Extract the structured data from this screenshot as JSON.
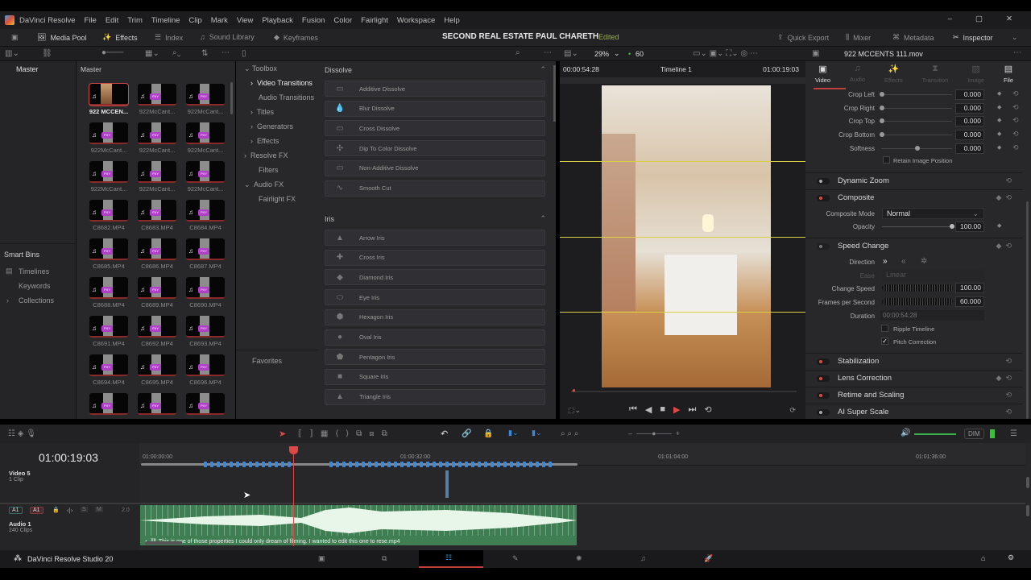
{
  "menu": {
    "app": "DaVinci Resolve",
    "items": [
      "File",
      "Edit",
      "Trim",
      "Timeline",
      "Clip",
      "Mark",
      "View",
      "Playback",
      "Fusion",
      "Color",
      "Fairlight",
      "Workspace",
      "Help"
    ]
  },
  "toolbar": {
    "media_pool": "Media Pool",
    "effects": "Effects",
    "index": "Index",
    "sound_library": "Sound Library",
    "keyframes": "Keyframes",
    "project_title": "SECOND REAL ESTATE PAUL CHARETH",
    "status": "Edited",
    "quick_export": "Quick Export",
    "mixer": "Mixer",
    "metadata": "Metadata",
    "inspector": "Inspector"
  },
  "viewer_bar": {
    "zoom": "29%",
    "fps": "60"
  },
  "bins": {
    "master": "Master",
    "smart_bins": "Smart Bins",
    "items": [
      "Timelines",
      "Keywords",
      "Collections"
    ]
  },
  "pool": {
    "title": "Master",
    "clips": [
      "922 MCCEN...",
      "922McCant...",
      "922McCant...",
      "922McCant...",
      "922McCant...",
      "922McCant...",
      "922McCant...",
      "922McCant...",
      "922McCant...",
      "C8682.MP4",
      "C8683.MP4",
      "C8684.MP4",
      "C8685.MP4",
      "C8686.MP4",
      "C8687.MP4",
      "C8688.MP4",
      "C8689.MP4",
      "C8690.MP4",
      "C8691.MP4",
      "C8692.MP4",
      "C8693.MP4",
      "C8694.MP4",
      "C8695.MP4",
      "C8696.MP4",
      "",
      "",
      ""
    ]
  },
  "effects_tree": {
    "toolbox": "Toolbox",
    "items": [
      "Video Transitions",
      "Audio Transitions",
      "Titles",
      "Generators",
      "Effects",
      "Resolve FX",
      "Filters",
      "Audio FX",
      "Fairlight FX"
    ],
    "favorites": "Favorites"
  },
  "effects": {
    "groups": [
      {
        "title": "Dissolve",
        "items": [
          "Additive Dissolve",
          "Blur Dissolve",
          "Cross Dissolve",
          "Dip To Color Dissolve",
          "Non-Additive Dissolve",
          "Smooth Cut"
        ]
      },
      {
        "title": "Iris",
        "items": [
          "Arrow Iris",
          "Cross Iris",
          "Diamond Iris",
          "Eye Iris",
          "Hexagon Iris",
          "Oval Iris",
          "Pentagon Iris",
          "Square Iris",
          "Triangle Iris"
        ]
      }
    ]
  },
  "viewer": {
    "source_tc": "00:00:54:28",
    "timeline": "Timeline 1",
    "record_tc": "01:00:19:03"
  },
  "inspector": {
    "clip_name": "922 MCCENTS 111.mov",
    "tabs": [
      "Video",
      "Audio",
      "Effects",
      "Transition",
      "Image",
      "File"
    ],
    "crop": [
      {
        "label": "Crop Left",
        "value": "0.000"
      },
      {
        "label": "Crop Right",
        "value": "0.000"
      },
      {
        "label": "Crop Top",
        "value": "0.000"
      },
      {
        "label": "Crop Bottom",
        "value": "0.000"
      },
      {
        "label": "Softness",
        "value": "0.000"
      }
    ],
    "retain": "Retain Image Position",
    "dynamic_zoom": "Dynamic Zoom",
    "composite": "Composite",
    "composite_mode_label": "Composite Mode",
    "composite_mode": "Normal",
    "opacity_label": "Opacity",
    "opacity": "100.00",
    "speed_change": "Speed Change",
    "direction": "Direction",
    "ease_label": "Ease",
    "ease": "Linear",
    "change_speed_label": "Change Speed",
    "change_speed": "100.00",
    "fps_label": "Frames per Second",
    "fps": "60.000",
    "duration_label": "Duration",
    "duration": "00:00:54:28",
    "ripple": "Ripple Timeline",
    "pitch": "Pitch Correction",
    "sections": [
      "Stabilization",
      "Lens Correction",
      "Retime and Scaling",
      "AI Super Scale"
    ]
  },
  "timeline": {
    "timecode": "01:00:19:03",
    "ruler": [
      "01:00:00:00",
      "01:00:32:00",
      "01:01:04:00",
      "01:01:36:00"
    ],
    "video_track": {
      "name": "Video 5",
      "clips": "1 Clip"
    },
    "audio_track": {
      "name": "Audio 1",
      "clips": "240 Clips",
      "a1": "A1",
      "a1b": "A1",
      "s": "S",
      "m": "M",
      "level": "2.0"
    },
    "audio_clip_name": "This is one of those properties I could only dream of filming. I wanted to edit this one to rese.mp4",
    "dim": "DIM"
  },
  "pagebar": {
    "app": "DaVinci Resolve Studio 20"
  }
}
